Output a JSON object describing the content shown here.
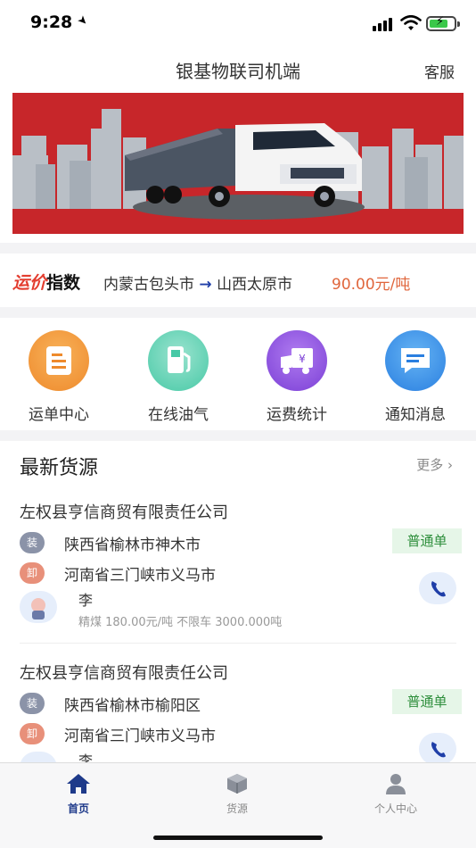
{
  "status_bar": {
    "time": "9:28"
  },
  "nav": {
    "title": "银基物联司机端",
    "service_label": "客服"
  },
  "price_index": {
    "logo_red": "运价",
    "logo_black": "指数",
    "origin": "内蒙古包头市",
    "destination": "山西太原市",
    "price": "90.00元/吨",
    "arrow": "→"
  },
  "menu": [
    {
      "label": "运单中心",
      "icon": "waybill-icon",
      "color": "#f29a3b"
    },
    {
      "label": "在线油气",
      "icon": "fuel-icon",
      "color": "#3cc8a4"
    },
    {
      "label": "运费统计",
      "icon": "freight-truck-icon",
      "color": "#8a4bd8"
    },
    {
      "label": "通知消息",
      "icon": "message-icon",
      "color": "#2f8ee8"
    }
  ],
  "latest": {
    "title": "最新货源",
    "more": "更多",
    "items": [
      {
        "company": "左权县亨信商贸有限责任公司",
        "load_tag": "装",
        "load_addr": "陕西省榆林市神木市",
        "unload_tag": "卸",
        "unload_addr": "河南省三门峡市义马市",
        "type": "普通单",
        "person": "李",
        "info": "精煤 180.00元/吨 不限车 3000.000吨"
      },
      {
        "company": "左权县亨信商贸有限责任公司",
        "load_tag": "装",
        "load_addr": "陕西省榆林市榆阳区",
        "unload_tag": "卸",
        "unload_addr": "河南省三门峡市义马市",
        "type": "普通单",
        "person": "李"
      }
    ]
  },
  "tabbar": [
    {
      "label": "首页",
      "icon": "home-icon",
      "active": true
    },
    {
      "label": "货源",
      "icon": "cargo-box-icon",
      "active": false
    },
    {
      "label": "个人中心",
      "icon": "profile-icon",
      "active": false
    }
  ],
  "colors": {
    "accent": "#1e3a8a",
    "price": "#e0663c",
    "banner_bg": "#c7262a"
  }
}
